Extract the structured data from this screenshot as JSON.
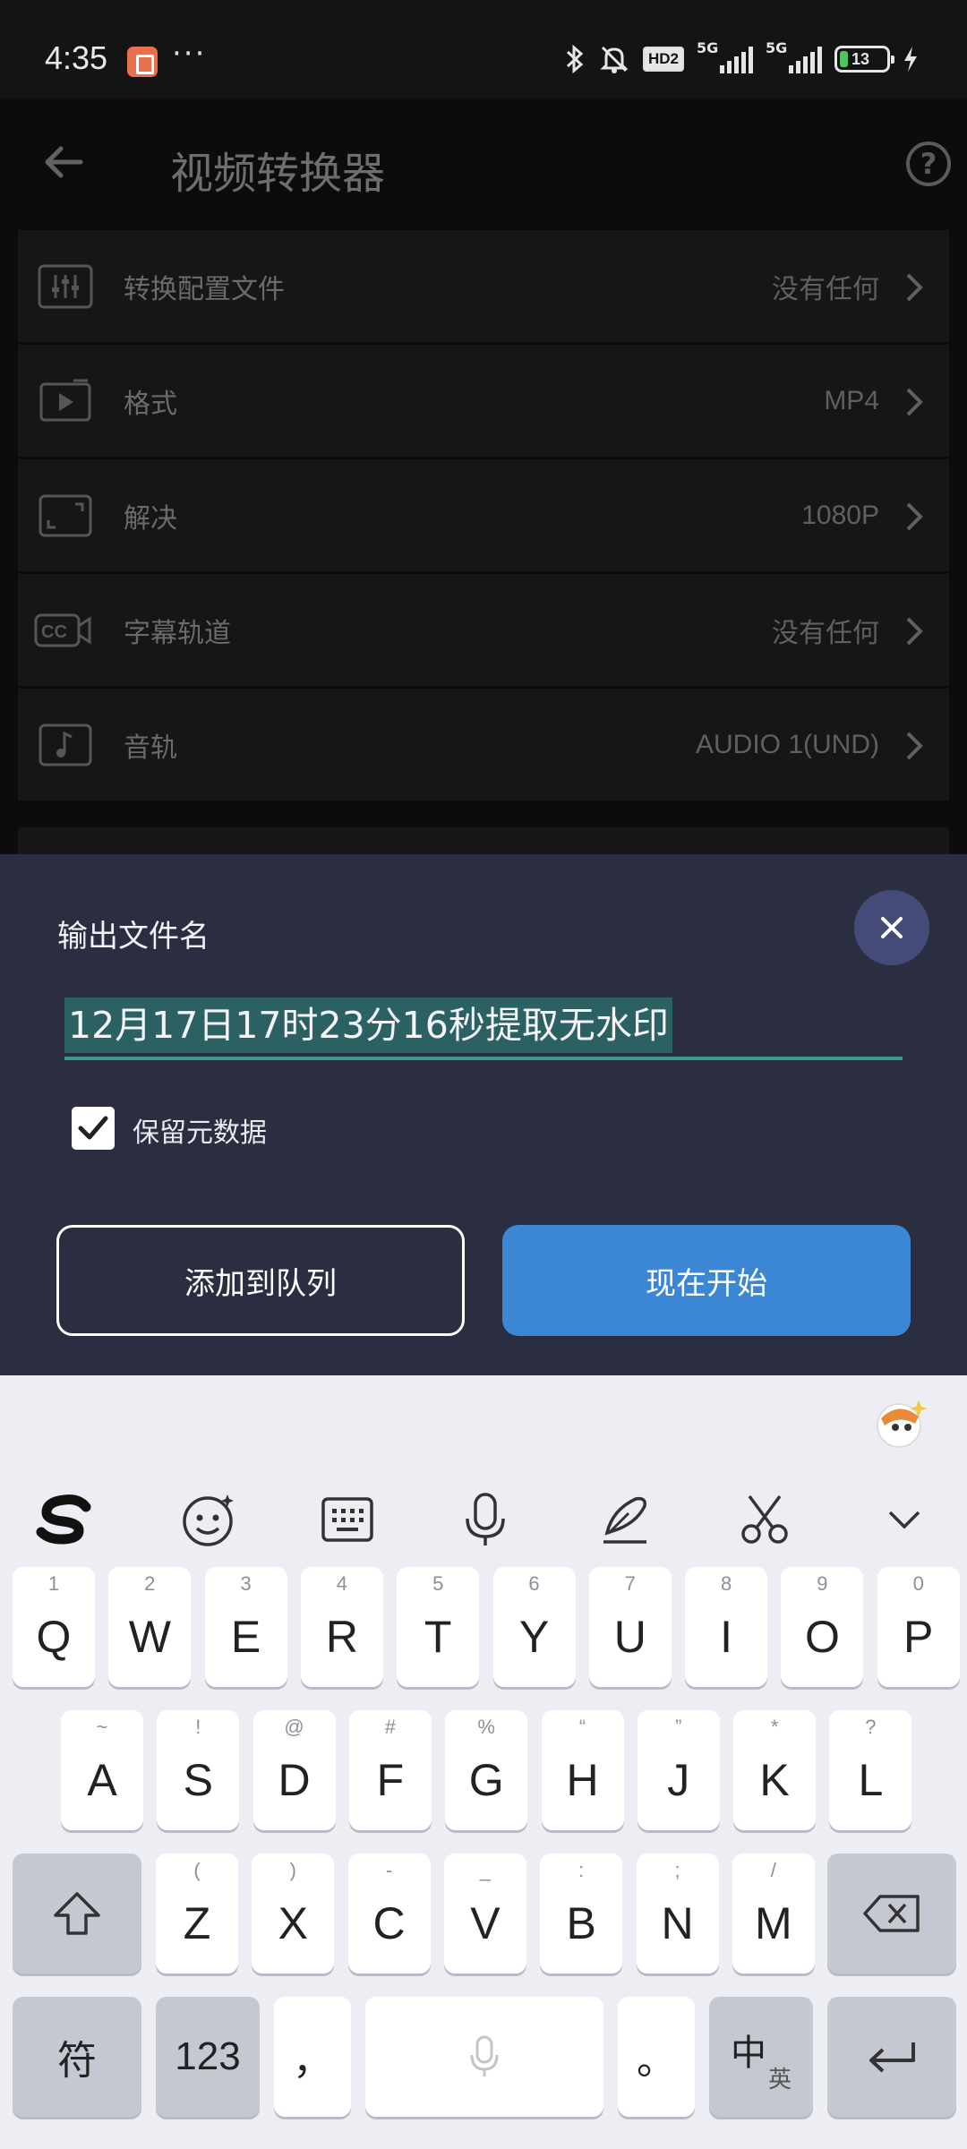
{
  "status_bar": {
    "time": "4:35",
    "dots": "···",
    "hd_badge": "HD2",
    "signal1_label": "5G",
    "signal2_label": "5G",
    "battery": "13"
  },
  "app": {
    "title": "视频转换器",
    "settings": [
      {
        "label": "转换配置文件",
        "value": "没有任何",
        "icon": "sliders-icon"
      },
      {
        "label": "格式",
        "value": "MP4",
        "icon": "video-format-icon"
      },
      {
        "label": "解决",
        "value": "1080P",
        "icon": "resolution-icon"
      },
      {
        "label": "字幕轨道",
        "value": "没有任何",
        "icon": "cc-subtitle-icon"
      },
      {
        "label": "音轨",
        "value": "AUDIO 1(UND)",
        "icon": "music-note-icon"
      }
    ]
  },
  "dialog": {
    "title": "输出文件名",
    "filename": "12月17日17时23分16秒提取无水印",
    "keep_metadata_label": "保留元数据",
    "keep_metadata_checked": true,
    "add_to_queue_label": "添加到队列",
    "start_now_label": "现在开始",
    "accent": "#3b87d4"
  },
  "keyboard": {
    "tools": [
      "sogou-logo-icon",
      "emoji-icon",
      "keyboard-icon",
      "microphone-icon",
      "handwriting-pen-icon",
      "scissors-icon",
      "chevron-down-icon"
    ],
    "row1": [
      {
        "k": "Q",
        "s": "1"
      },
      {
        "k": "W",
        "s": "2"
      },
      {
        "k": "E",
        "s": "3"
      },
      {
        "k": "R",
        "s": "4"
      },
      {
        "k": "T",
        "s": "5"
      },
      {
        "k": "Y",
        "s": "6"
      },
      {
        "k": "U",
        "s": "7"
      },
      {
        "k": "I",
        "s": "8"
      },
      {
        "k": "O",
        "s": "9"
      },
      {
        "k": "P",
        "s": "0"
      }
    ],
    "row2": [
      {
        "k": "A",
        "s": "~"
      },
      {
        "k": "S",
        "s": "!"
      },
      {
        "k": "D",
        "s": "@"
      },
      {
        "k": "F",
        "s": "#"
      },
      {
        "k": "G",
        "s": "%"
      },
      {
        "k": "H",
        "s": "“"
      },
      {
        "k": "J",
        "s": "”"
      },
      {
        "k": "K",
        "s": "*"
      },
      {
        "k": "L",
        "s": "?"
      }
    ],
    "row3": [
      {
        "k": "Z",
        "s": "("
      },
      {
        "k": "X",
        "s": ")"
      },
      {
        "k": "C",
        "s": "-"
      },
      {
        "k": "V",
        "s": "_"
      },
      {
        "k": "B",
        "s": ":"
      },
      {
        "k": "N",
        "s": ";"
      },
      {
        "k": "M",
        "s": "/"
      }
    ],
    "symbols_label": "符",
    "numbers_label": "123",
    "comma_label": "，",
    "period_label": "。",
    "lang_main": "中",
    "lang_sub": "英"
  }
}
